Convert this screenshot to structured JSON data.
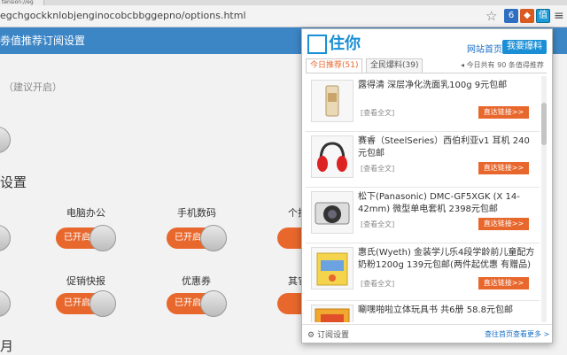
{
  "browser": {
    "tab_fragment": "tension://eg",
    "url": "egchgockknlobjenginocobcbbggepno/options.html",
    "icons": {
      "star": "star-icon",
      "ext1": "ext-6-icon",
      "ext2": "ext-fox-icon",
      "ext3": "ext-zhuni-icon",
      "menu": "menu-icon"
    },
    "ext1_label": "6",
    "ext3_label": "值"
  },
  "settings": {
    "header_title": "劵值推荐订阅设置",
    "note": "（建议开启）",
    "section_title": "设置",
    "section2_title": "月",
    "toggle_label": "已开启",
    "categories": [
      "电脑办公",
      "手机数码",
      "个护",
      "促销快报",
      "优惠券",
      "其它"
    ]
  },
  "popup": {
    "logo_text": "住你",
    "site_link": "网站首页",
    "report_button": "我要爆料",
    "tab_today": "今日推荐(51)",
    "tab_all": "全民爆料(39)",
    "summary": "今日共有 90 条值得推荐",
    "items": [
      {
        "title": "露得清 深层净化洗面乳100g 9元包邮",
        "read": "[查看全文]",
        "go": "直达链接>>",
        "thumb": "cream-tube"
      },
      {
        "title": "赛睿（SteelSeries）西伯利亚v1 耳机 240元包邮",
        "read": "[查看全文]",
        "go": "直达链接>>",
        "thumb": "headphones"
      },
      {
        "title": "松下(Panasonic) DMC-GF5XGK (X 14-42mm) 微型单电套机 2398元包邮",
        "read": "[查看全文]",
        "go": "直达链接>>",
        "thumb": "camera"
      },
      {
        "title": "惠氏(Wyeth) 金装学儿乐4段学龄前儿童配方奶粉1200g 139元包邮(两件起优惠 有赠品)",
        "read": "[查看全文]",
        "go": "直达链接>>",
        "thumb": "milk-box"
      },
      {
        "title": "唰嘿啪啦立体玩具书 共6册 58.8元包邮",
        "read": "",
        "go": "",
        "thumb": "book"
      }
    ],
    "footer_settings": "订阅设置",
    "footer_more": "查往首页查看更多 >"
  },
  "colors": {
    "accent": "#e8672c",
    "blue": "#1a8fd6",
    "header": "#3d86c6"
  }
}
